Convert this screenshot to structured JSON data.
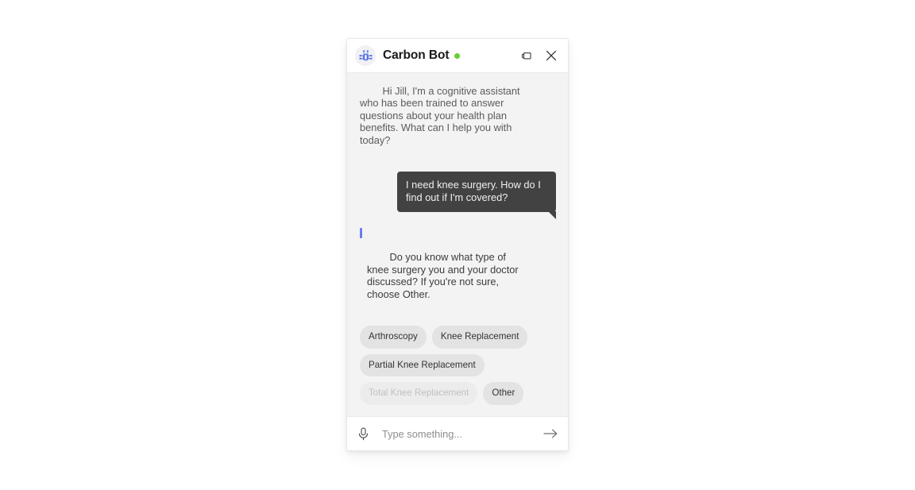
{
  "widget": {
    "header": {
      "avatar_icon": "robot-bot-avatar-icon",
      "title": "Carbon Bot",
      "status": "online",
      "status_color": "#6dcc2f",
      "restore_label": "restore-window",
      "close_label": "close"
    },
    "conversation": [
      {
        "role": "bot",
        "text": "Hi Jill, I'm a cognitive assistant who has been trained to answer questions about your health plan benefits. What can I help you with today?",
        "accent": false
      },
      {
        "role": "user",
        "text": "I need knee surgery. How do I find out if I'm covered?"
      },
      {
        "role": "bot",
        "text": "Do you know what type of knee surgery you and your doctor discussed? If you're not sure, choose Other.",
        "accent": true,
        "accent_color": "#6a7cf0"
      }
    ],
    "quick_replies": [
      {
        "label": "Arthroscopy",
        "state": "default"
      },
      {
        "label": "Knee Replacement",
        "state": "default"
      },
      {
        "label": "Partial Knee Replacement",
        "state": "default"
      },
      {
        "label": "Total Knee Replacement",
        "state": "faded"
      },
      {
        "label": "Other",
        "state": "default"
      }
    ],
    "composer": {
      "mic_icon": "microphone-icon",
      "placeholder": "Type something...",
      "value": "",
      "send_icon": "arrow-right-icon"
    }
  }
}
